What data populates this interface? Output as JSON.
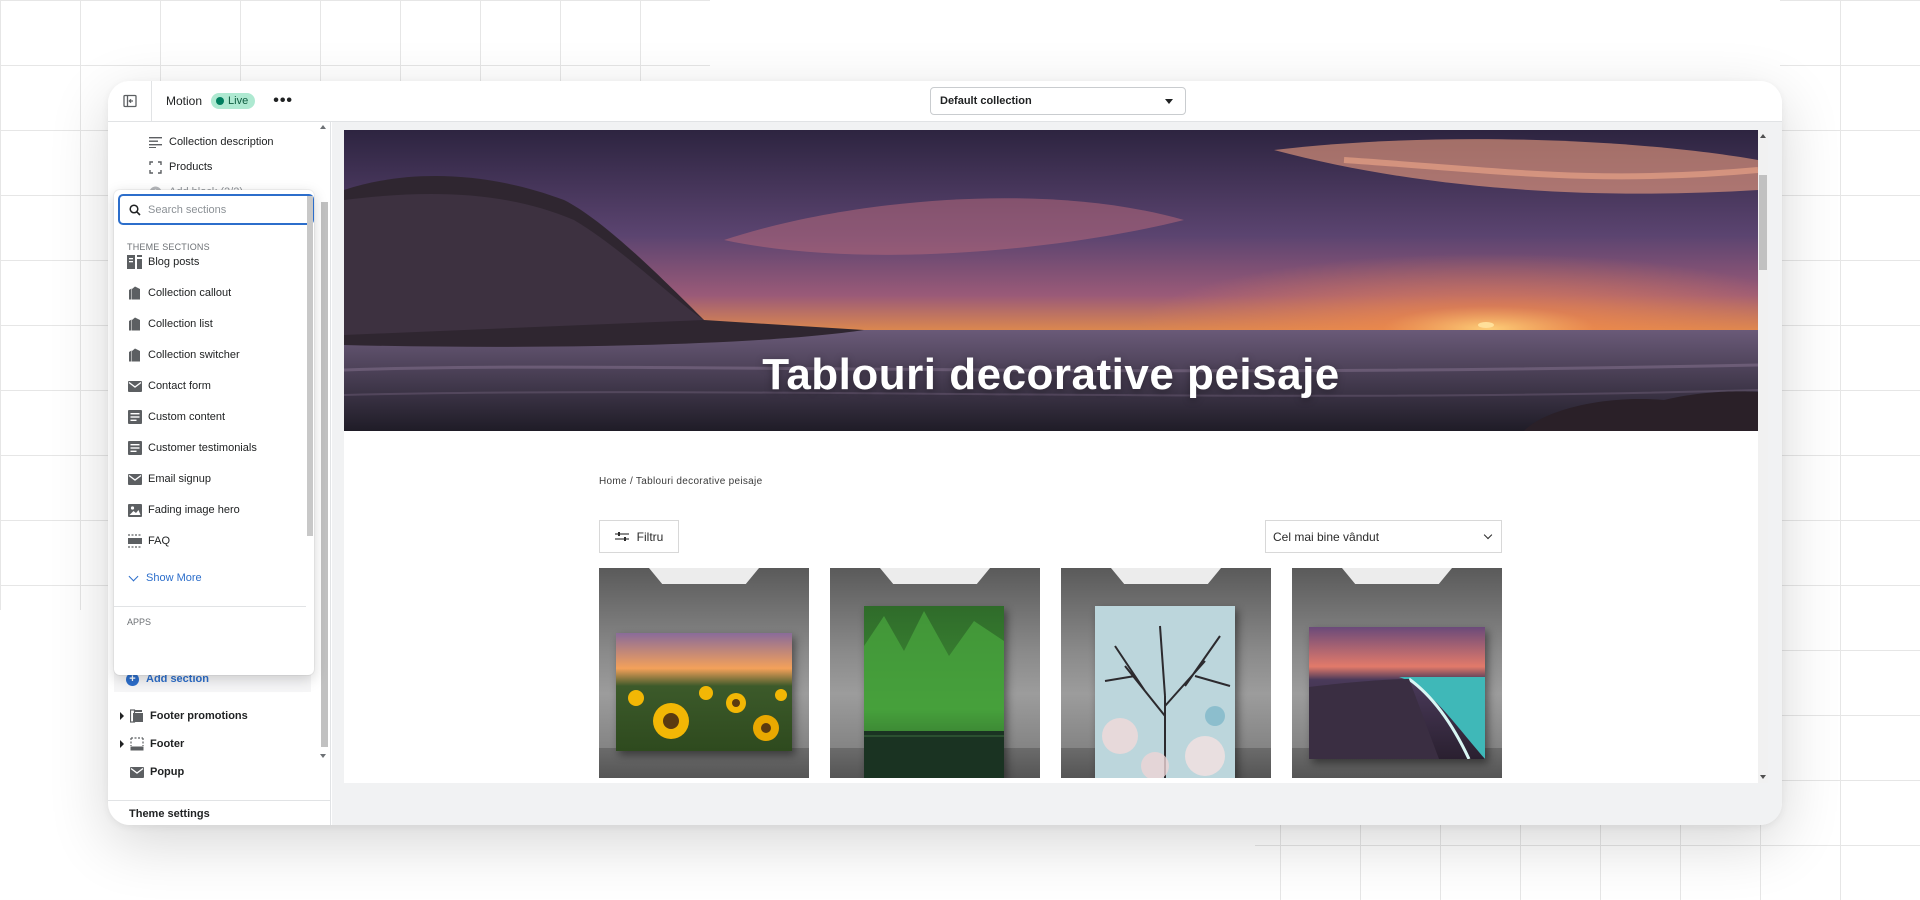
{
  "topbar": {
    "theme_name": "Motion",
    "live_badge": "Live",
    "more_label": "•••",
    "collection_select": "Default collection"
  },
  "sidebar": {
    "blocks": [
      {
        "label": "Collection description",
        "icon": "text-lines-icon"
      },
      {
        "label": "Products",
        "icon": "products-icon"
      },
      {
        "label": "Add block (2/2)",
        "icon": "add-circle-icon",
        "disabled": true
      }
    ],
    "add_section": "Add section",
    "sections": [
      {
        "label": "Footer promotions",
        "icon": "promotions-icon",
        "expandable": true
      },
      {
        "label": "Footer",
        "icon": "footer-icon",
        "expandable": true
      },
      {
        "label": "Popup",
        "icon": "envelope-icon",
        "expandable": false
      }
    ],
    "theme_settings": "Theme settings"
  },
  "popover": {
    "search_placeholder": "Search sections",
    "heading": "THEME SECTIONS",
    "items": [
      {
        "label": "Blog posts",
        "icon": "blog-icon"
      },
      {
        "label": "Collection callout",
        "icon": "collection-icon"
      },
      {
        "label": "Collection list",
        "icon": "collection-icon"
      },
      {
        "label": "Collection switcher",
        "icon": "collection-icon"
      },
      {
        "label": "Contact form",
        "icon": "envelope-icon"
      },
      {
        "label": "Custom content",
        "icon": "content-icon"
      },
      {
        "label": "Customer testimonials",
        "icon": "content-icon"
      },
      {
        "label": "Email signup",
        "icon": "envelope-icon"
      },
      {
        "label": "Fading image hero",
        "icon": "image-icon"
      },
      {
        "label": "FAQ",
        "icon": "faq-icon"
      }
    ],
    "show_more": "Show More",
    "apps_heading": "APPS"
  },
  "preview": {
    "hero_title": "Tablouri decorative peisaje",
    "breadcrumb": "Home / Tablouri decorative peisaje",
    "filter_label": "Filtru",
    "sort_label": "Cel mai bine vândut",
    "products": [
      {
        "name": "sunflowers-canvas"
      },
      {
        "name": "forest-lake-canvas"
      },
      {
        "name": "blossom-tree-canvas"
      },
      {
        "name": "sunset-beach-canvas"
      }
    ]
  },
  "colors": {
    "accent": "#2c6ecb",
    "live_bg": "#aee9d1",
    "live_dot": "#007f5f"
  }
}
